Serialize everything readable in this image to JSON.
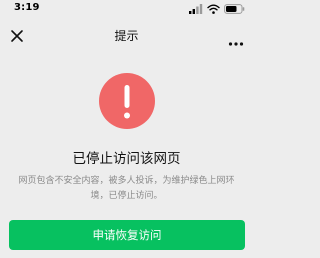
{
  "status_bar": {
    "time": "3:19",
    "icons": [
      "signal-icon",
      "wifi-icon",
      "battery-icon"
    ]
  },
  "nav": {
    "title": "提示",
    "close_icon": "close-icon",
    "more_icon": "more-icon"
  },
  "main": {
    "alert_icon": "exclamation-icon",
    "headline": "已停止访问该网页",
    "description": "网页包含不安全内容，被多人投诉，为维护绿色上网环境，已停止访问。",
    "button_label": "申请恢复访问"
  },
  "colors": {
    "background": "#ededed",
    "alert_red": "#f06767",
    "button_green": "#07c160",
    "description_gray": "#8a8a8a"
  }
}
